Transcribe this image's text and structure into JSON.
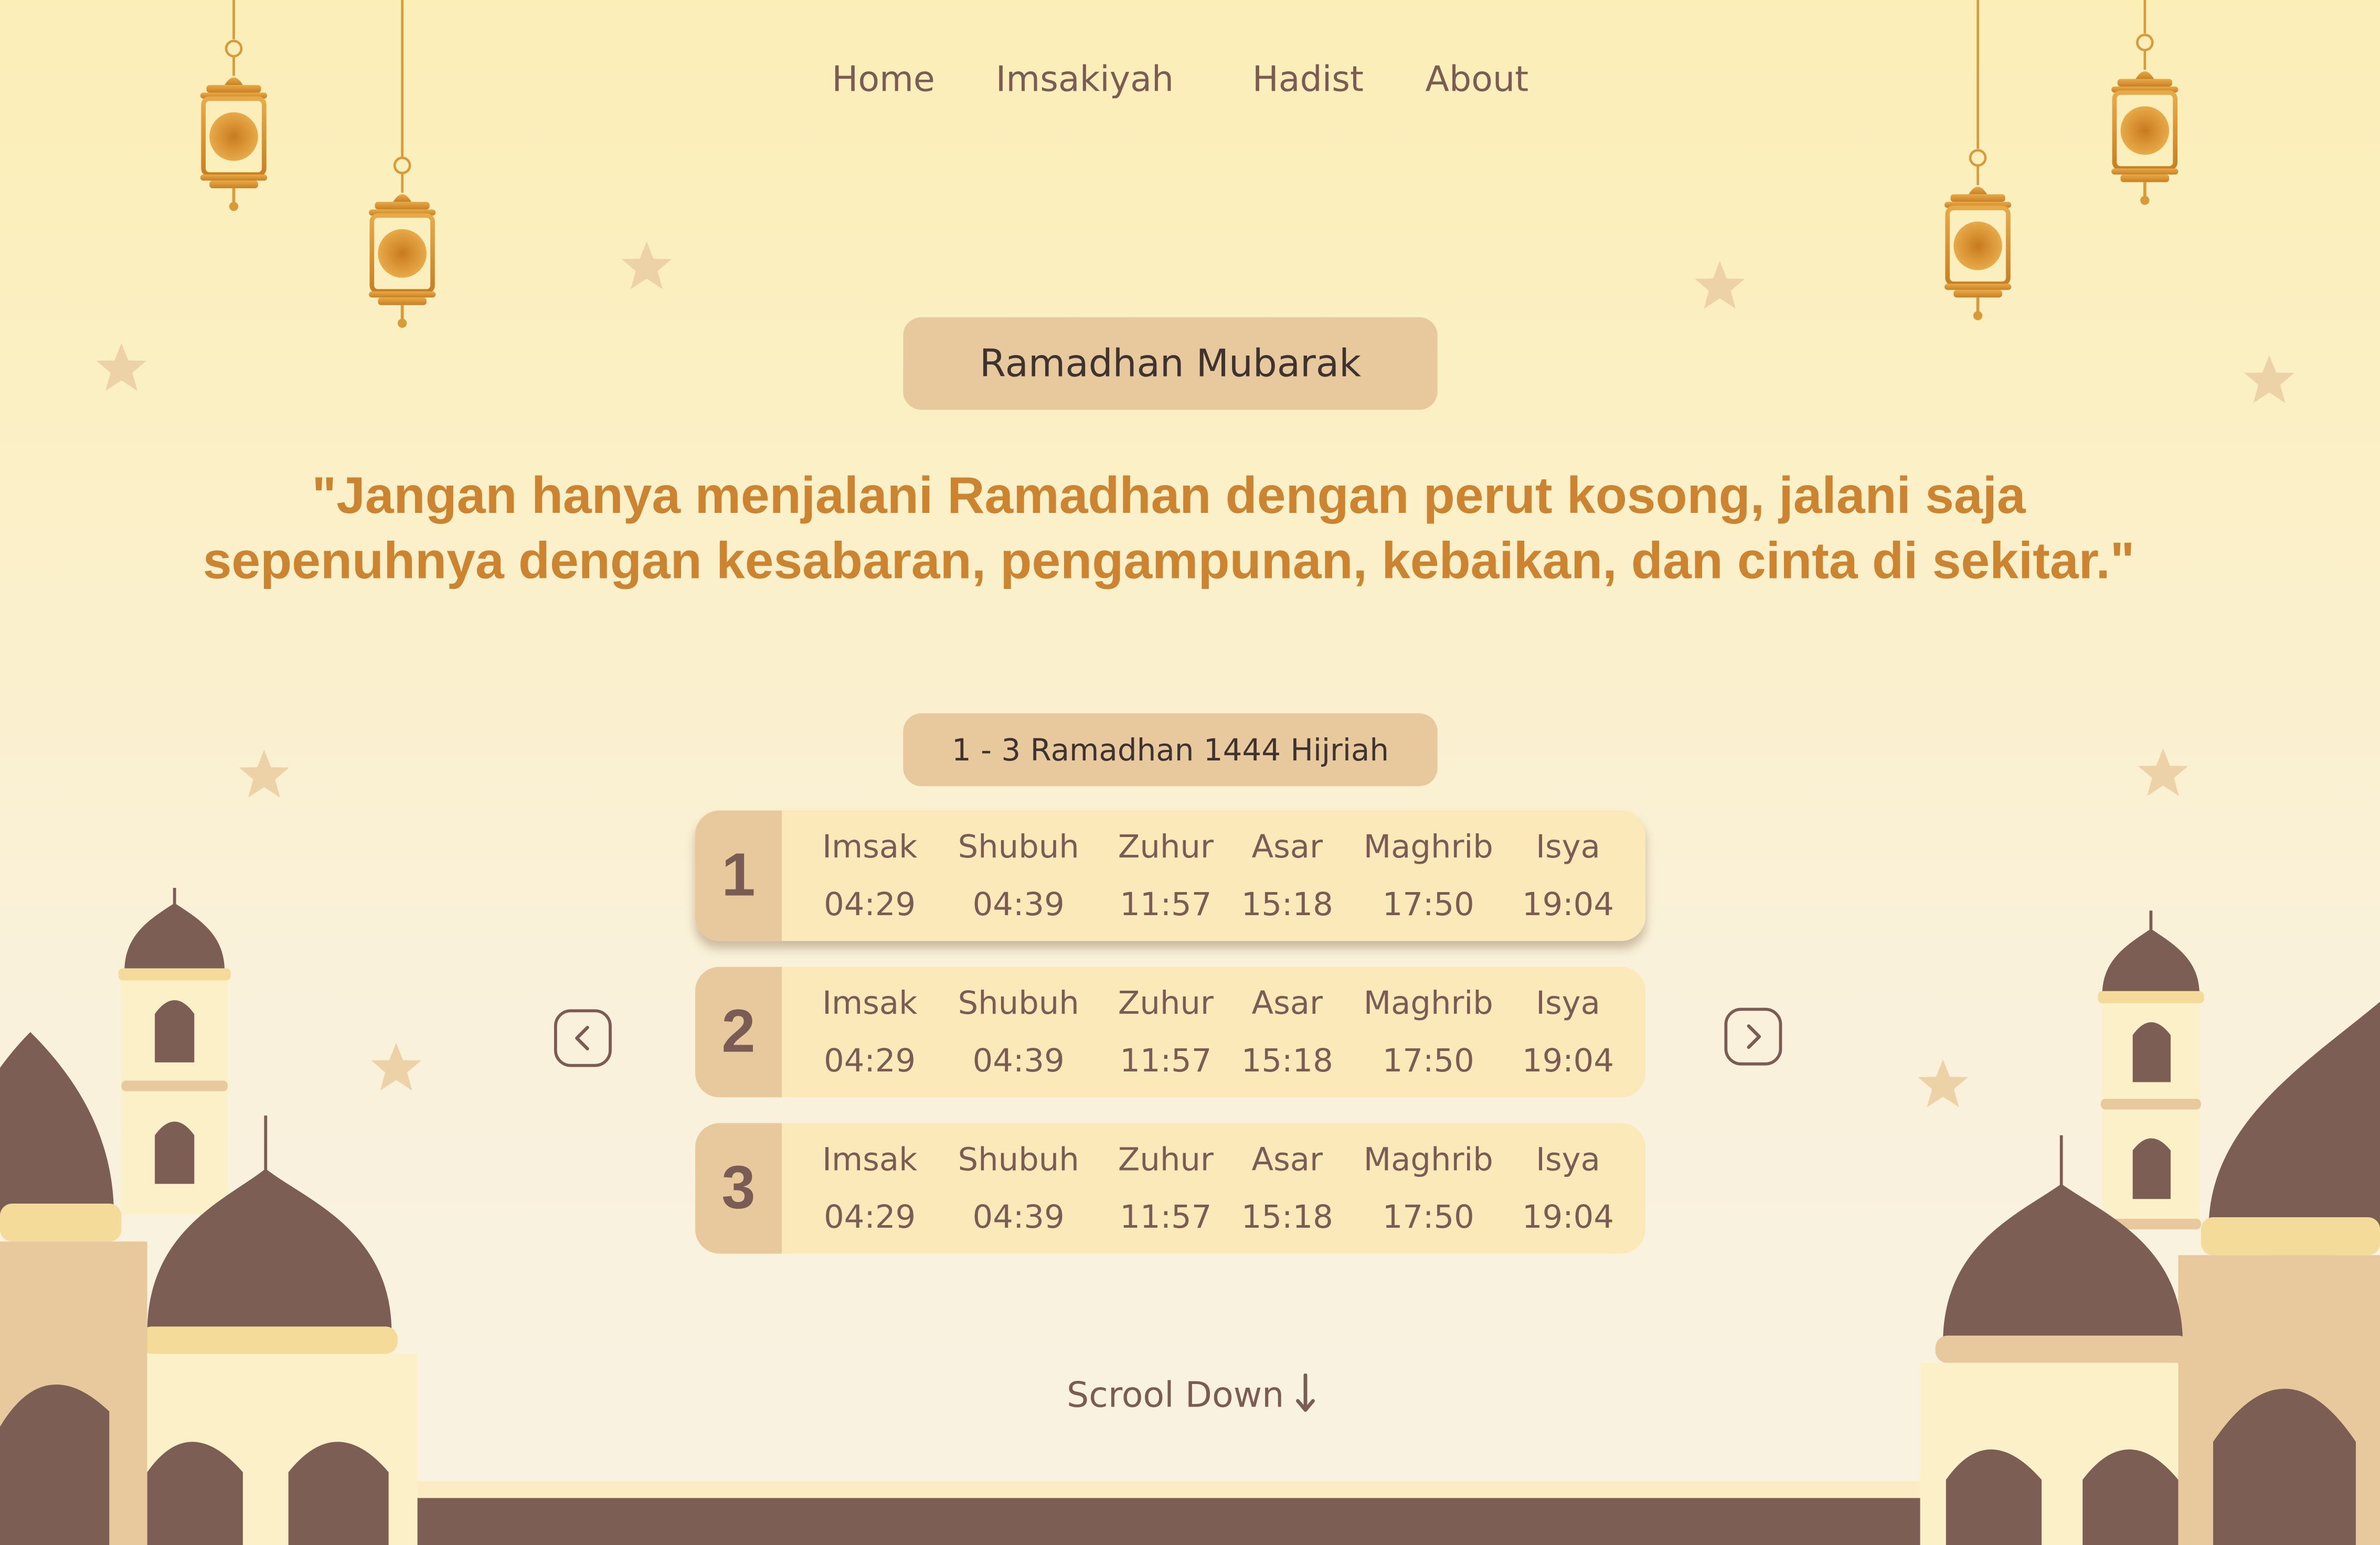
{
  "nav": {
    "items": [
      {
        "label": "Home"
      },
      {
        "label": "Imsakiyah"
      },
      {
        "label": "Hadist"
      },
      {
        "label": "About"
      }
    ]
  },
  "header": {
    "badge": "Ramadhan Mubarak",
    "quote": "\"Jangan hanya menjalani Ramadhan dengan perut kosong, jalani saja sepenuhnya dengan kesabaran, pengampunan, kebaikan, dan cinta di sekitar.\""
  },
  "schedule": {
    "range_label": "1 - 3 Ramadhan 1444 Hijriah",
    "columns": [
      "Imsak",
      "Shubuh",
      "Zuhur",
      "Asar",
      "Maghrib",
      "Isya"
    ],
    "days": [
      {
        "day": "1",
        "times": [
          "04:29",
          "04:39",
          "11:57",
          "15:18",
          "17:50",
          "19:04"
        ]
      },
      {
        "day": "2",
        "times": [
          "04:29",
          "04:39",
          "11:57",
          "15:18",
          "17:50",
          "19:04"
        ]
      },
      {
        "day": "3",
        "times": [
          "04:29",
          "04:39",
          "11:57",
          "15:18",
          "17:50",
          "19:04"
        ]
      }
    ]
  },
  "footer": {
    "scroll_label": "Scrool Down"
  },
  "colors": {
    "accent": "#cc8430",
    "brown": "#7a5c55",
    "pill": "#e8c99e",
    "card": "#fbe9ba",
    "gold": "#d99a3a"
  },
  "icons": [
    "lantern-icon",
    "star-icon",
    "chevron-left-icon",
    "chevron-right-icon",
    "arrow-down-icon",
    "mosque-illustration"
  ]
}
